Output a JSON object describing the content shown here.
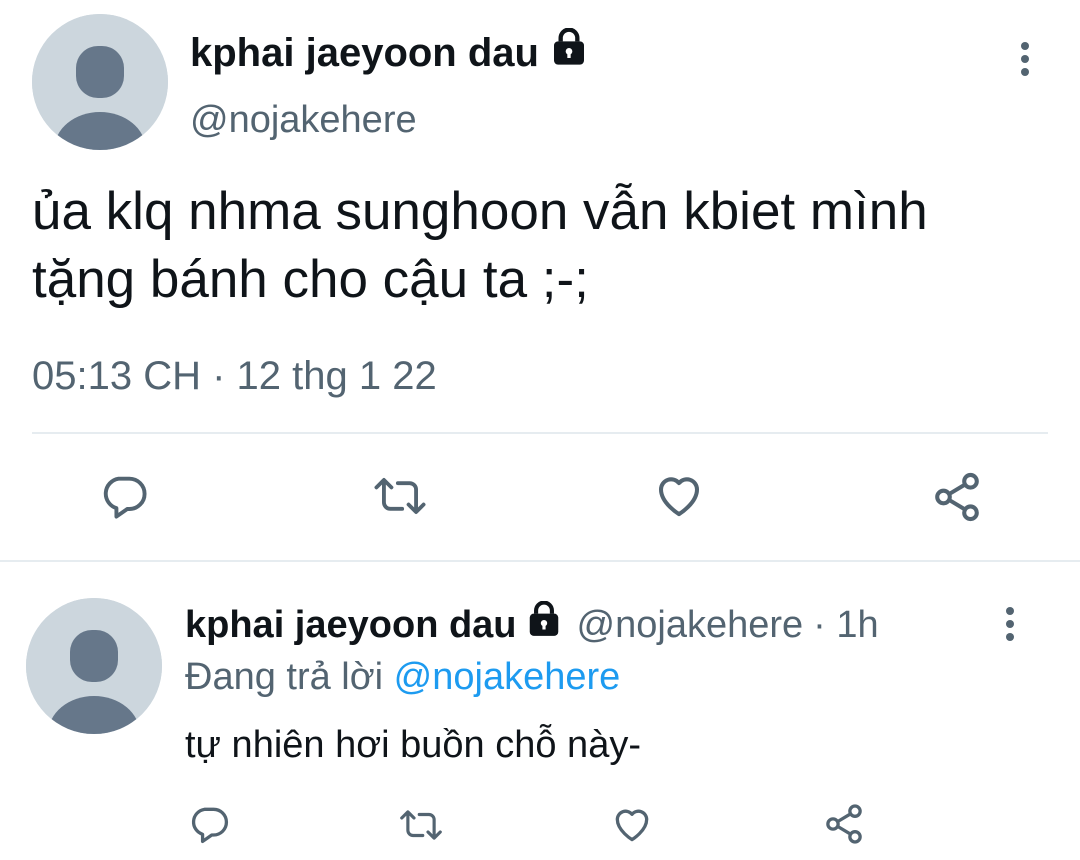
{
  "main_tweet": {
    "display_name": "kphai jaeyoon dau",
    "handle": "@nojakehere",
    "text_line1": "ủa klq nhma sunghoon vẫn kbiet mình",
    "text_line2": "tặng bánh cho cậu ta ;-;",
    "timestamp": "05:13 CH · 12 thg 1 22",
    "actions": [
      "reply-icon",
      "retweet-icon",
      "like-icon",
      "share-icon"
    ]
  },
  "reply_tweet": {
    "display_name": "kphai jaeyoon dau",
    "handle": "@nojakehere",
    "time_ago": "· 1h",
    "replying_label": "Đang trả lời",
    "replying_to": "@nojakehere",
    "text": "tự nhiên hơi buồn chỗ này-",
    "actions": [
      "reply-icon",
      "retweet-icon",
      "like-icon",
      "share-icon"
    ]
  },
  "colors": {
    "secondary_text": "#536471",
    "link": "#1d9bf0",
    "avatar_bg": "#ccd6dd",
    "avatar_fg": "#66778a",
    "divider": "#e6ecf0"
  }
}
